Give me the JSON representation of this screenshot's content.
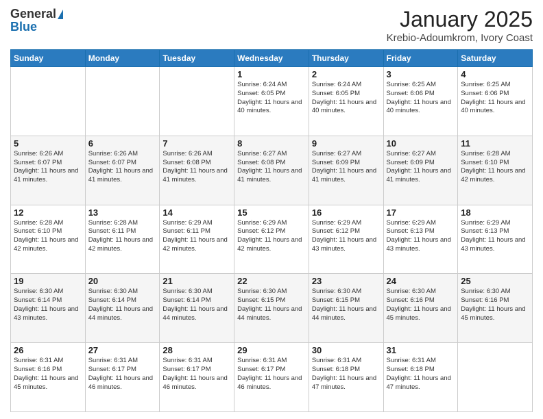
{
  "header": {
    "logo_general": "General",
    "logo_blue": "Blue",
    "month_title": "January 2025",
    "location": "Krebio-Adoumkrom, Ivory Coast"
  },
  "days_of_week": [
    "Sunday",
    "Monday",
    "Tuesday",
    "Wednesday",
    "Thursday",
    "Friday",
    "Saturday"
  ],
  "weeks": [
    [
      {
        "day": "",
        "info": ""
      },
      {
        "day": "",
        "info": ""
      },
      {
        "day": "",
        "info": ""
      },
      {
        "day": "1",
        "info": "Sunrise: 6:24 AM\nSunset: 6:05 PM\nDaylight: 11 hours and 40 minutes."
      },
      {
        "day": "2",
        "info": "Sunrise: 6:24 AM\nSunset: 6:05 PM\nDaylight: 11 hours and 40 minutes."
      },
      {
        "day": "3",
        "info": "Sunrise: 6:25 AM\nSunset: 6:06 PM\nDaylight: 11 hours and 40 minutes."
      },
      {
        "day": "4",
        "info": "Sunrise: 6:25 AM\nSunset: 6:06 PM\nDaylight: 11 hours and 40 minutes."
      }
    ],
    [
      {
        "day": "5",
        "info": "Sunrise: 6:26 AM\nSunset: 6:07 PM\nDaylight: 11 hours and 41 minutes."
      },
      {
        "day": "6",
        "info": "Sunrise: 6:26 AM\nSunset: 6:07 PM\nDaylight: 11 hours and 41 minutes."
      },
      {
        "day": "7",
        "info": "Sunrise: 6:26 AM\nSunset: 6:08 PM\nDaylight: 11 hours and 41 minutes."
      },
      {
        "day": "8",
        "info": "Sunrise: 6:27 AM\nSunset: 6:08 PM\nDaylight: 11 hours and 41 minutes."
      },
      {
        "day": "9",
        "info": "Sunrise: 6:27 AM\nSunset: 6:09 PM\nDaylight: 11 hours and 41 minutes."
      },
      {
        "day": "10",
        "info": "Sunrise: 6:27 AM\nSunset: 6:09 PM\nDaylight: 11 hours and 41 minutes."
      },
      {
        "day": "11",
        "info": "Sunrise: 6:28 AM\nSunset: 6:10 PM\nDaylight: 11 hours and 42 minutes."
      }
    ],
    [
      {
        "day": "12",
        "info": "Sunrise: 6:28 AM\nSunset: 6:10 PM\nDaylight: 11 hours and 42 minutes."
      },
      {
        "day": "13",
        "info": "Sunrise: 6:28 AM\nSunset: 6:11 PM\nDaylight: 11 hours and 42 minutes."
      },
      {
        "day": "14",
        "info": "Sunrise: 6:29 AM\nSunset: 6:11 PM\nDaylight: 11 hours and 42 minutes."
      },
      {
        "day": "15",
        "info": "Sunrise: 6:29 AM\nSunset: 6:12 PM\nDaylight: 11 hours and 42 minutes."
      },
      {
        "day": "16",
        "info": "Sunrise: 6:29 AM\nSunset: 6:12 PM\nDaylight: 11 hours and 43 minutes."
      },
      {
        "day": "17",
        "info": "Sunrise: 6:29 AM\nSunset: 6:13 PM\nDaylight: 11 hours and 43 minutes."
      },
      {
        "day": "18",
        "info": "Sunrise: 6:29 AM\nSunset: 6:13 PM\nDaylight: 11 hours and 43 minutes."
      }
    ],
    [
      {
        "day": "19",
        "info": "Sunrise: 6:30 AM\nSunset: 6:14 PM\nDaylight: 11 hours and 43 minutes."
      },
      {
        "day": "20",
        "info": "Sunrise: 6:30 AM\nSunset: 6:14 PM\nDaylight: 11 hours and 44 minutes."
      },
      {
        "day": "21",
        "info": "Sunrise: 6:30 AM\nSunset: 6:14 PM\nDaylight: 11 hours and 44 minutes."
      },
      {
        "day": "22",
        "info": "Sunrise: 6:30 AM\nSunset: 6:15 PM\nDaylight: 11 hours and 44 minutes."
      },
      {
        "day": "23",
        "info": "Sunrise: 6:30 AM\nSunset: 6:15 PM\nDaylight: 11 hours and 44 minutes."
      },
      {
        "day": "24",
        "info": "Sunrise: 6:30 AM\nSunset: 6:16 PM\nDaylight: 11 hours and 45 minutes."
      },
      {
        "day": "25",
        "info": "Sunrise: 6:30 AM\nSunset: 6:16 PM\nDaylight: 11 hours and 45 minutes."
      }
    ],
    [
      {
        "day": "26",
        "info": "Sunrise: 6:31 AM\nSunset: 6:16 PM\nDaylight: 11 hours and 45 minutes."
      },
      {
        "day": "27",
        "info": "Sunrise: 6:31 AM\nSunset: 6:17 PM\nDaylight: 11 hours and 46 minutes."
      },
      {
        "day": "28",
        "info": "Sunrise: 6:31 AM\nSunset: 6:17 PM\nDaylight: 11 hours and 46 minutes."
      },
      {
        "day": "29",
        "info": "Sunrise: 6:31 AM\nSunset: 6:17 PM\nDaylight: 11 hours and 46 minutes."
      },
      {
        "day": "30",
        "info": "Sunrise: 6:31 AM\nSunset: 6:18 PM\nDaylight: 11 hours and 47 minutes."
      },
      {
        "day": "31",
        "info": "Sunrise: 6:31 AM\nSunset: 6:18 PM\nDaylight: 11 hours and 47 minutes."
      },
      {
        "day": "",
        "info": ""
      }
    ]
  ]
}
